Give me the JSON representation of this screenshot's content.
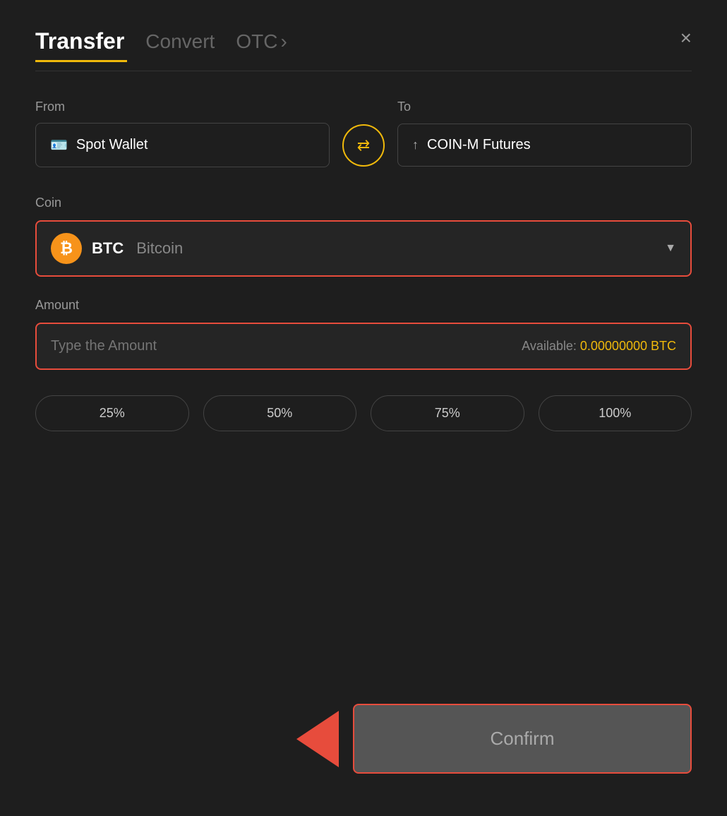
{
  "header": {
    "tab_transfer": "Transfer",
    "tab_convert": "Convert",
    "tab_otc": "OTC",
    "tab_otc_chevron": "›",
    "close_icon": "×"
  },
  "from_section": {
    "label": "From",
    "wallet_icon": "🪪",
    "wallet_name": "Spot Wallet"
  },
  "to_section": {
    "label": "To",
    "futures_icon": "↑",
    "futures_name": "COIN-M Futures"
  },
  "swap": {
    "icon": "⇄"
  },
  "coin_section": {
    "label": "Coin",
    "coin_symbol": "BTC",
    "coin_name": "Bitcoin",
    "coin_icon": "₿"
  },
  "amount_section": {
    "label": "Amount",
    "placeholder": "Type the Amount",
    "available_label": "Available:",
    "available_value": "0.00000000 BTC"
  },
  "pct_buttons": [
    "25%",
    "50%",
    "75%",
    "100%"
  ],
  "confirm_button": {
    "label": "Confirm"
  }
}
